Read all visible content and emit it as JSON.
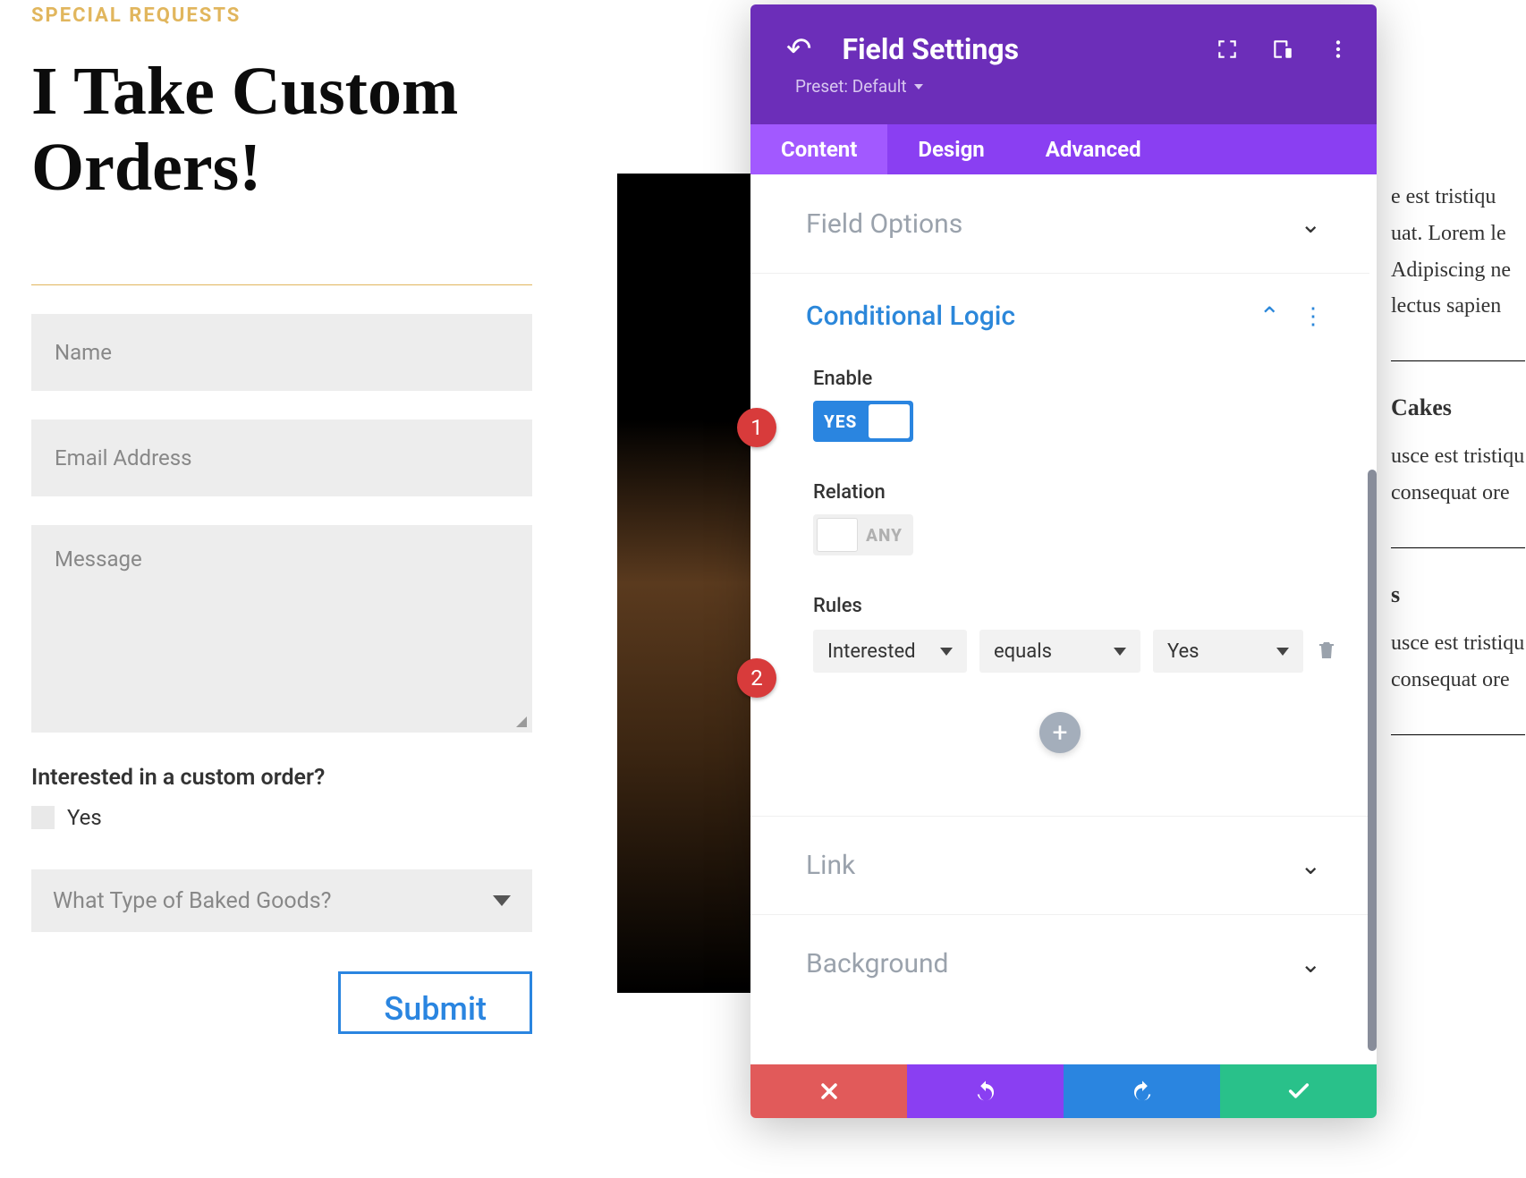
{
  "form": {
    "eyebrow": "SPECIAL REQUESTS",
    "heading": "I Take Custom Orders!",
    "name_placeholder": "Name",
    "email_placeholder": "Email Address",
    "message_placeholder": "Message",
    "question_label": "Interested in a custom order?",
    "option_yes": "Yes",
    "select_placeholder": "What Type of Baked Goods?",
    "submit_label": "Submit"
  },
  "modal": {
    "title": "Field Settings",
    "preset_label": "Preset: Default",
    "tabs": {
      "content": "Content",
      "design": "Design",
      "advanced": "Advanced"
    },
    "sections": {
      "field_options": "Field Options",
      "conditional_logic": "Conditional Logic",
      "link": "Link",
      "background": "Background"
    },
    "cond": {
      "enable_label": "Enable",
      "enable_state": "YES",
      "relation_label": "Relation",
      "relation_state": "ANY",
      "rules_label": "Rules",
      "rule_field": "Interested",
      "rule_op": "equals",
      "rule_val": "Yes"
    }
  },
  "badges": {
    "b1": "1",
    "b2": "2"
  },
  "bg": {
    "l1": "e est tristiqu",
    "l2": "uat. Lorem le",
    "l3": "Adipiscing ne",
    "l4": "lectus sapien",
    "h1": "Cakes",
    "l5": "usce est tristiqu",
    "l6": "consequat ore",
    "h2": "s",
    "l7": "usce est tristiqu",
    "l8": "consequat ore"
  }
}
